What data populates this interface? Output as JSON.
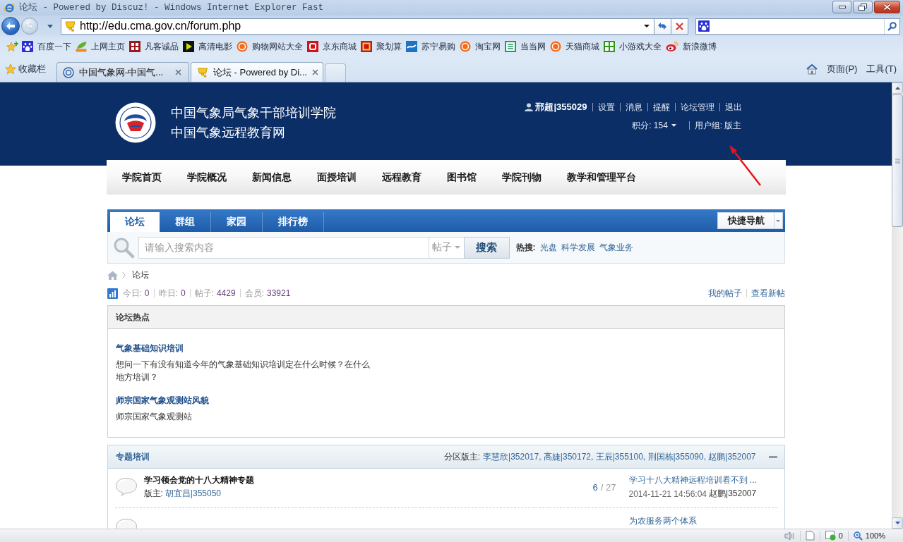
{
  "window": {
    "title": "论坛 - Powered by Discuz! - Windows Internet Explorer Fast"
  },
  "address_bar": {
    "url": "http://edu.cma.gov.cn/forum.php"
  },
  "links_bar": [
    "百度一下",
    "上网主页",
    "凡客诚品",
    "高清电影",
    "购物网站大全",
    "京东商城",
    "聚划算",
    "苏宁易购",
    "淘宝网",
    "当当网",
    "天猫商城",
    "小游戏大全",
    "新浪微博"
  ],
  "favorites": {
    "label": "收藏栏"
  },
  "browser_tabs": [
    {
      "label": "中国气象网-中国气...",
      "selected": false
    },
    {
      "label": "论坛 - Powered by Di...",
      "selected": true
    }
  ],
  "command_bar": [
    "页面(P)",
    "工具(T)"
  ],
  "site_header": {
    "title_lines": [
      "中国气象局气象干部培训学院",
      "中国气象远程教育网"
    ],
    "user": "邢超|355029",
    "user_links": [
      "设置",
      "消息",
      "提醒",
      "论坛管理",
      "退出"
    ],
    "credits": "积分: 154",
    "user_group": "用户组: 版主"
  },
  "main_nav": [
    "学院首页",
    "学院概况",
    "新闻信息",
    "面授培训",
    "远程教育",
    "图书馆",
    "学院刊物",
    "教学和管理平台"
  ],
  "forum_nav": {
    "tabs": [
      {
        "label": "论坛",
        "selected": true
      },
      {
        "label": "群组",
        "selected": false
      },
      {
        "label": "家园",
        "selected": false
      },
      {
        "label": "排行榜",
        "selected": false
      }
    ],
    "quick_nav": "快捷导航"
  },
  "search": {
    "placeholder": "请输入搜索内容",
    "type": "帖子",
    "button": "搜索",
    "hot_label": "热搜:",
    "hot_terms": [
      "光盘",
      "科学发展",
      "气象业务"
    ]
  },
  "breadcrumb": [
    "论坛"
  ],
  "stats": [
    {
      "label": "今日:",
      "value": "0"
    },
    {
      "label": "昨日:",
      "value": "0"
    },
    {
      "label": "帖子:",
      "value": "4429"
    },
    {
      "label": "会员:",
      "value": "33921"
    }
  ],
  "stats_links": [
    "我的帖子",
    "查看新帖"
  ],
  "hot_box": {
    "title": "论坛热点",
    "items": [
      {
        "title": "气象基础知识培训",
        "summary": "想问一下有没有知道今年的气象基础知识培训定在什么时候？在什么地方培训？"
      },
      {
        "title": "师宗国家气象观测站风貌",
        "summary": "师宗国家气象观测站"
      }
    ]
  },
  "section": {
    "title": "专题培训",
    "moderators_label": "分区版主:",
    "moderators": "李慧欣|352017, 高婕|350172, 王辰|355100, 荆国栋|355090, 赵鹏|352007",
    "forums": [
      {
        "title": "学习领会党的十八大精神专题",
        "moderator_label": "版主:",
        "moderator": "胡宜昌|355050",
        "threads": "6",
        "posts": "/ 27",
        "last_post_title": "学习十八大精神远程培训看不到 ...",
        "last_post_time": "2014-11-21 14:56:04",
        "last_post_author": "赵鹏|352007"
      },
      {
        "last_post_title": "为农服务两个体系"
      }
    ]
  },
  "status_bar": {
    "popups_blocked": "0",
    "zoom": "100%"
  }
}
